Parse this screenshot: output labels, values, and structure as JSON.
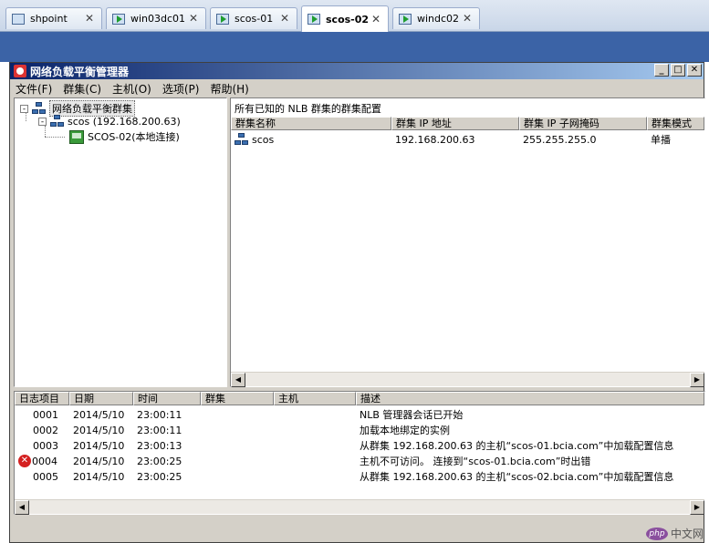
{
  "tabs": [
    {
      "label": "shpoint",
      "active": false,
      "powered": false,
      "close": "✕"
    },
    {
      "label": "win03dc01",
      "active": false,
      "powered": true,
      "close": "✕"
    },
    {
      "label": "scos-01",
      "active": false,
      "powered": true,
      "close": "✕"
    },
    {
      "label": "scos-02",
      "active": true,
      "powered": true,
      "close": "✕"
    },
    {
      "label": "windc02",
      "active": false,
      "powered": true,
      "close": "✕"
    }
  ],
  "window": {
    "title": "网络负载平衡管理器",
    "btn_min": "_",
    "btn_max": "□",
    "btn_close": "✕"
  },
  "menu": [
    "文件(F)",
    "群集(C)",
    "主机(O)",
    "选项(P)",
    "帮助(H)"
  ],
  "tree": {
    "root": "网络负载平衡群集",
    "root_expander": "-",
    "cluster": "scos (192.168.200.63)",
    "cluster_expander": "-",
    "host": "SCOS-02(本地连接)"
  },
  "list": {
    "header": "所有已知的 NLB 群集的群集配置",
    "columns": [
      "群集名称",
      "群集 IP 地址",
      "群集 IP 子网掩码",
      "群集模式"
    ],
    "rows": [
      {
        "name": "scos",
        "ip": "192.168.200.63",
        "mask": "255.255.255.0",
        "mode": "单播"
      }
    ]
  },
  "log": {
    "columns": [
      "日志项目",
      "日期",
      "时间",
      "群集",
      "主机",
      "描述"
    ],
    "rows": [
      {
        "id": "0001",
        "date": "2014/5/10",
        "time": "23:00:11",
        "cluster": "",
        "host": "",
        "desc": "NLB 管理器会话已开始",
        "error": false
      },
      {
        "id": "0002",
        "date": "2014/5/10",
        "time": "23:00:11",
        "cluster": "",
        "host": "",
        "desc": "加载本地绑定的实例",
        "error": false
      },
      {
        "id": "0003",
        "date": "2014/5/10",
        "time": "23:00:13",
        "cluster": "",
        "host": "",
        "desc": "从群集 192.168.200.63 的主机“scos-01.bcia.com”中加载配置信息",
        "error": false
      },
      {
        "id": "0004",
        "date": "2014/5/10",
        "time": "23:00:25",
        "cluster": "",
        "host": "",
        "desc": "主机不可访问。 连接到“scos-01.bcia.com”时出错",
        "error": true
      },
      {
        "id": "0005",
        "date": "2014/5/10",
        "time": "23:00:25",
        "cluster": "",
        "host": "",
        "desc": "从群集 192.168.200.63 的主机“scos-02.bcia.com”中加载配置信息",
        "error": false
      }
    ]
  },
  "error_glyph": "✕",
  "scroll": {
    "left": "◀",
    "right": "▶"
  },
  "watermark": {
    "logo": "php",
    "text": "中文网"
  },
  "colors": {
    "titlebar": "#0a246a",
    "bluestrip": "#3b63a6",
    "face": "#d4d0c8",
    "error": "#d42020"
  }
}
